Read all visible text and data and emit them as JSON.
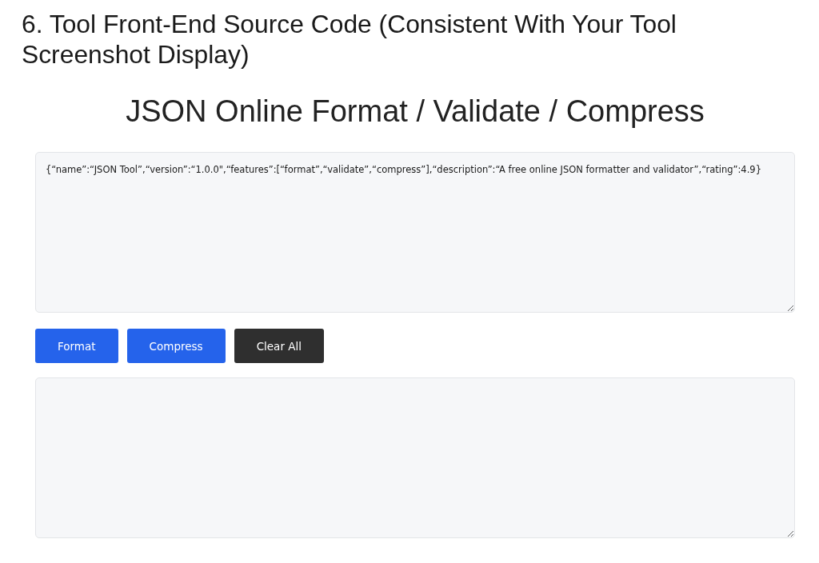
{
  "heading": "6. Tool Front-End Source Code (Consistent With Your Tool Screenshot Display)",
  "tool": {
    "title": "JSON Online Format / Validate / Compress",
    "input": {
      "value": "{“name”:“JSON Tool”,“version”:“1.0.0\",“features”:[“format”,“validate”,“compress”],“description”:“A free online JSON formatter and validator”,“rating”:4.9}",
      "resizable": true
    },
    "buttons": [
      {
        "label": "Format",
        "kind": "primary"
      },
      {
        "label": "Compress",
        "kind": "primary"
      },
      {
        "label": "Clear All",
        "kind": "dark"
      }
    ],
    "output": {
      "resizable": true
    }
  }
}
